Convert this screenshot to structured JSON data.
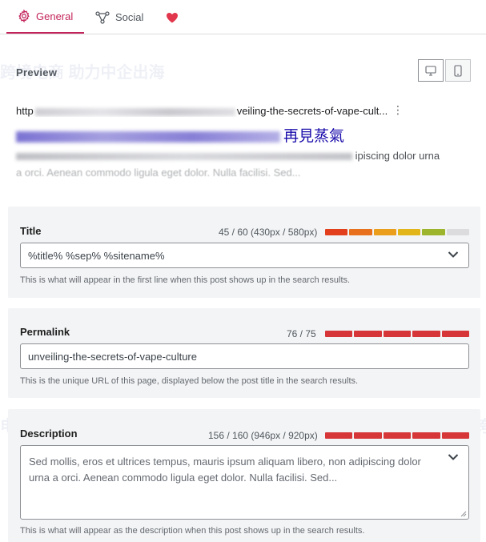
{
  "tabs": {
    "general": "General",
    "social": "Social"
  },
  "accent_color": "#c3235b",
  "preview": {
    "heading": "Preview",
    "url_prefix": "http",
    "url_suffix": "veiling-the-secrets-of-vape-cult...",
    "title_suffix": "再見蒸氣",
    "desc_line1_end": "ipiscing dolor urna",
    "desc_line2": "a orci. Aenean commodo ligula eget dolor. Nulla facilisi. Sed..."
  },
  "title_field": {
    "label": "Title",
    "counter": "45 / 60 (430px / 580px)",
    "value": "%title% %sep% %sitename%",
    "helper": "This is what will appear in the first line when this post shows up in the search results."
  },
  "permalink_field": {
    "label": "Permalink",
    "counter": "76 / 75",
    "value": "unveiling-the-secrets-of-vape-culture",
    "helper": "This is the unique URL of this page, displayed below the post title in the search results."
  },
  "description_field": {
    "label": "Description",
    "counter": "156 / 160 (946px / 920px)",
    "value": "Sed mollis, eros et ultrices tempus, mauris ipsum aliquam libero, non adipiscing dolor urna a orci. Aenean commodo ligula eget dolor. Nulla facilisi. Sed...",
    "helper": "This is what will appear as the description when this post shows up in the search results."
  },
  "watermark": {
    "line1": "跨境电商 助力中企出海",
    "line2": "服务跨境电商 助力中企出海",
    "line3": "电商 助力中企出海",
    "line4": "服务跨"
  }
}
